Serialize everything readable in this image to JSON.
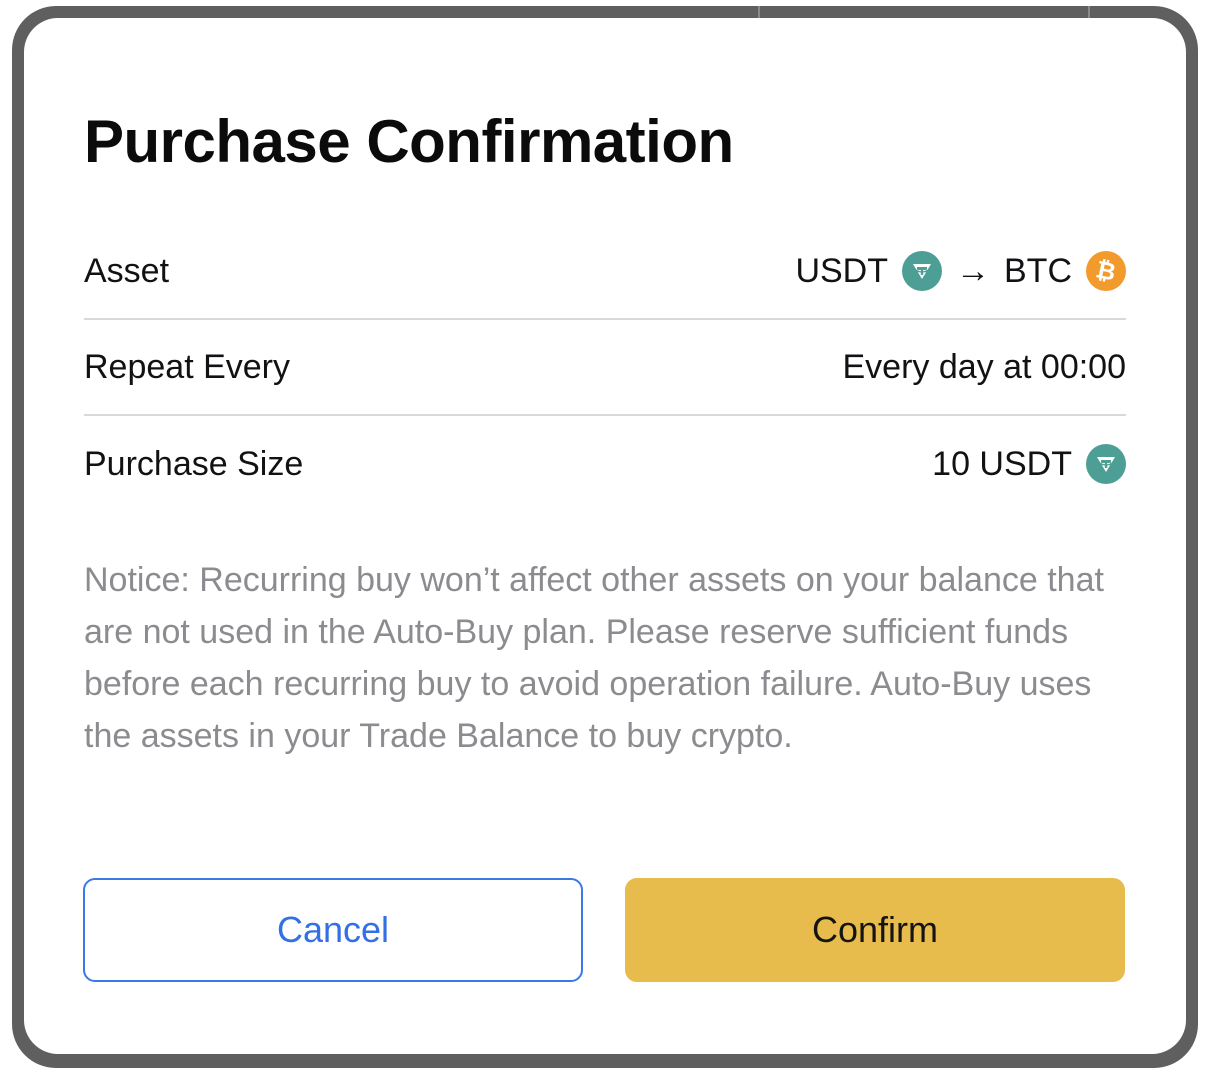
{
  "dialog": {
    "title": "Purchase Confirmation",
    "rows": [
      {
        "label": "Asset",
        "from": "USDT",
        "arrow": "→",
        "to": "BTC",
        "from_icon": "usdt-icon",
        "to_icon": "btc-icon"
      },
      {
        "label": "Repeat Every",
        "value": "Every day at 00:00"
      },
      {
        "label": "Purchase Size",
        "value": "10 USDT",
        "icon": "usdt-icon"
      }
    ],
    "notice": "Notice: Recurring buy won’t affect other assets on your balance that are not used in the Auto-Buy plan. Please reserve sufficient funds before each recurring buy to avoid operation failure. Auto-Buy uses the assets in your Trade Balance to buy crypto.",
    "cancel_label": "Cancel",
    "confirm_label": "Confirm"
  },
  "colors": {
    "usdt": "#4d9f96",
    "btc": "#f29b2c",
    "confirm_bg": "#e7bc4c",
    "cancel_accent": "#3270e4",
    "notice_text": "#8c8c90"
  }
}
